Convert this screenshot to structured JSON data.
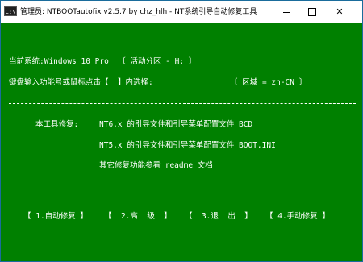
{
  "window": {
    "icon_text": "C:\\",
    "title": "管理员:  NTBOOTautofix v2.5.7 by chz_hlh - NT系统引导自动修复工具",
    "minimize_label": "",
    "maximize_label": "",
    "close_label": "✕"
  },
  "console": {
    "current_system": "当前系统:Windows 10 Pro  〔 活动分区 - H: 〕",
    "prompt": "键盘输入功能号或鼠标点击【  】内选择:",
    "region": "〔 区域 = zh-CN 〕",
    "repair_label": "本工具修复:",
    "repair_nt6": "NT6.x 的引导文件和引导菜单配置文件 BCD",
    "repair_nt5": "NT5.x 的引导文件和引导菜单配置文件 BOOT.INI",
    "repair_other": "其它修复功能参看 readme 文档"
  },
  "menu": {
    "auto_repair": "【 1.自动修复 】",
    "advanced": "【  2.高  级  】",
    "exit": "【  3.退  出  】",
    "manual_repair": "【 4.手动修复 】"
  },
  "colors": {
    "background": "#008000",
    "text": "#ffffff"
  }
}
